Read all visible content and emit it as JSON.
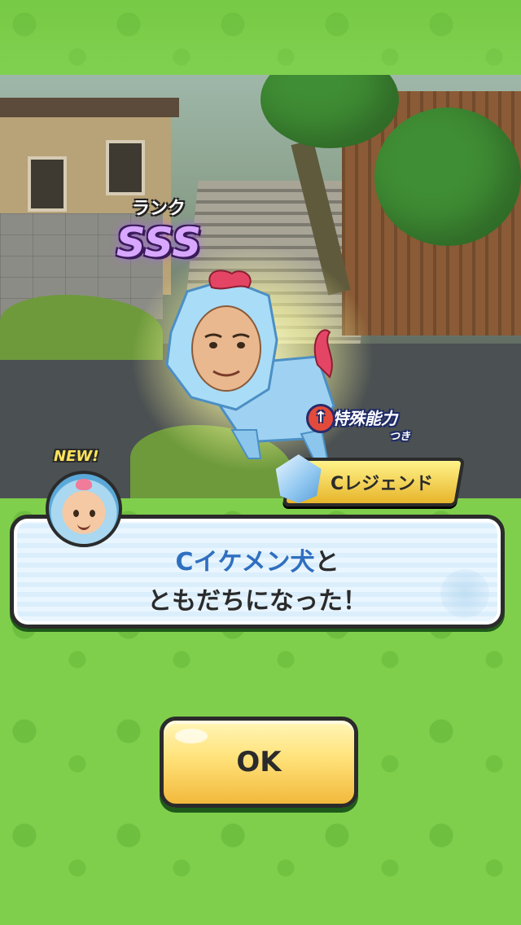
{
  "result": {
    "rank_label": "ランク",
    "rank_value": "SSS",
    "special_ability_label": "特殊能力",
    "special_ability_sub": "つき",
    "legend_tag": "Cレジェンド",
    "new_badge": "NEW!"
  },
  "dialog": {
    "name": "Cイケメン犬",
    "particle": "と",
    "line2": "ともだちになった！"
  },
  "ok_button": {
    "label": "OK"
  },
  "colors": {
    "background_green": "#7fcf4c",
    "dialog_name_blue": "#2f6fc0",
    "button_gold": "#ffe27a",
    "rank_purple": "#d8a7ff"
  }
}
